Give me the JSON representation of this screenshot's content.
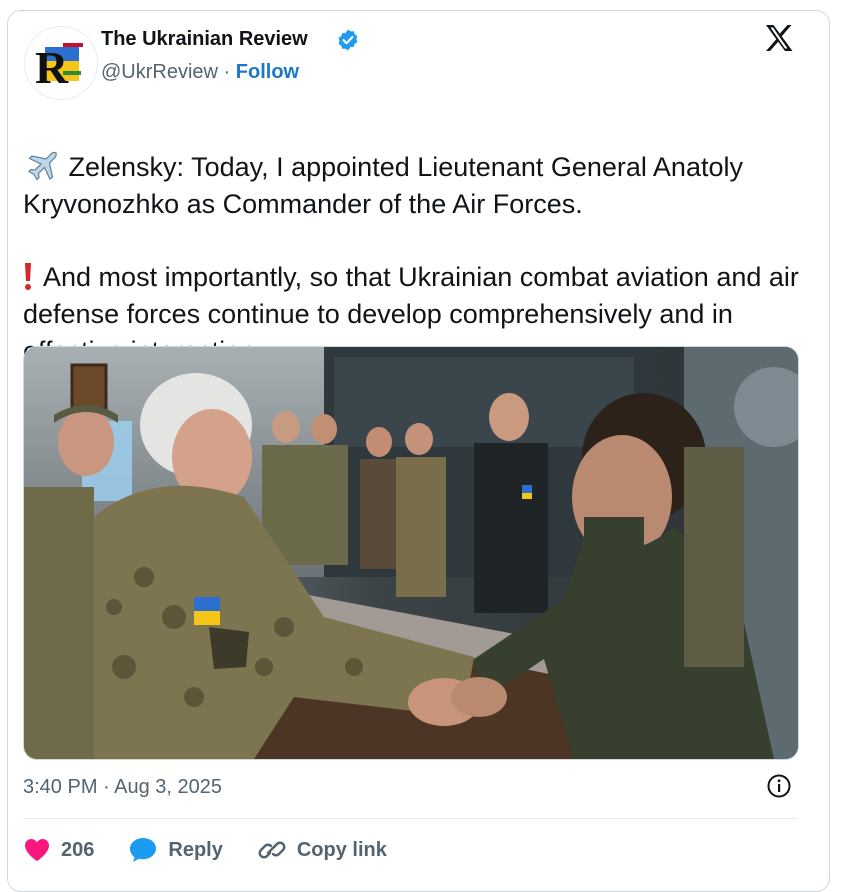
{
  "account": {
    "name": "The Ukrainian Review",
    "handle": "@UkrReview",
    "separator": " · ",
    "follow_label": "Follow",
    "logo_letter": "R"
  },
  "tweet": {
    "line1": "Zelensky: Today, I appointed Lieutenant General Anatoly Kryvonozhko as Commander of the Air Forces.",
    "line2": "And most importantly, so that Ukrainian combat aviation and air defense forces continue to develop comprehensively and in effective interaction."
  },
  "meta": {
    "timestamp": "3:40 PM · Aug 3, 2025"
  },
  "actions": {
    "likes": "206",
    "reply_label": "Reply",
    "copy_link_label": "Copy link"
  },
  "colors": {
    "accent": "#1d77c5",
    "like": "#f91880",
    "flag_blue": "#2c6fcf",
    "flag_yellow": "#f5c518"
  },
  "icons": [
    "verified-badge-icon",
    "x-logo-icon",
    "ukraine-flag-icon",
    "airplane-icon",
    "exclamation-icon",
    "info-icon",
    "heart-icon",
    "reply-bubble-icon",
    "link-icon"
  ]
}
